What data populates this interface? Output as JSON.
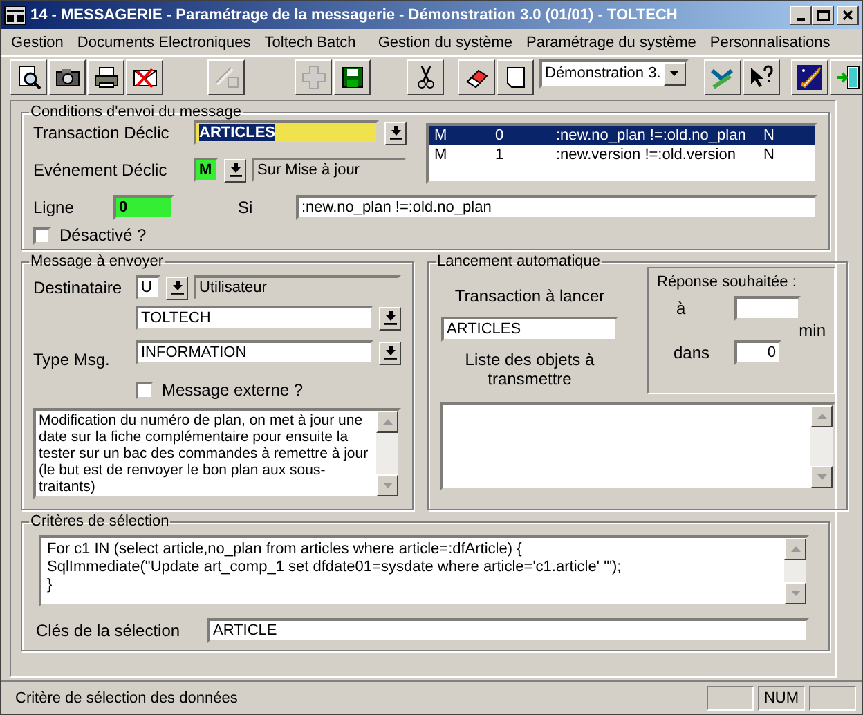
{
  "window": {
    "title": "14 - MESSAGERIE - Paramétrage de la messagerie - Démonstration 3.0 (01/01) - TOLTECH"
  },
  "menu": [
    "Gestion",
    "Documents Electroniques",
    "Toltech Batch",
    "Gestion du système",
    "Paramétrage du système",
    "Personnalisations"
  ],
  "toolbar": {
    "groups": [
      [
        {
          "kind": "search",
          "disabled": false
        },
        {
          "kind": "camera",
          "disabled": false
        },
        {
          "kind": "print",
          "disabled": false
        },
        {
          "kind": "mail-cross",
          "disabled": false
        }
      ],
      [
        {
          "kind": "validate",
          "disabled": true
        }
      ],
      [
        {
          "kind": "add",
          "disabled": true
        },
        {
          "kind": "save",
          "disabled": false
        }
      ],
      [
        {
          "kind": "cut",
          "disabled": false
        }
      ],
      [
        {
          "kind": "erase",
          "disabled": false
        },
        {
          "kind": "page",
          "disabled": false
        },
        {
          "kind": "combo",
          "value": "Démonstration 3."
        }
      ],
      [
        {
          "kind": "tools",
          "disabled": false
        },
        {
          "kind": "help",
          "disabled": false
        }
      ],
      [
        {
          "kind": "rocket",
          "disabled": false
        },
        {
          "kind": "exit",
          "disabled": false
        }
      ]
    ]
  },
  "conditions": {
    "title": "Conditions d'envoi du message",
    "transaction": {
      "label": "Transaction Déclic",
      "value": "ARTICLES",
      "text_selected": true
    },
    "event": {
      "label": "Evénement Déclic",
      "code": "M",
      "description": "Sur Mise à jour"
    },
    "line": {
      "label": "Ligne",
      "value": "0"
    },
    "condition": {
      "label": "Si",
      "value": ":new.no_plan !=:old.no_plan"
    },
    "disabled_checkbox": {
      "label": "Désactivé ?",
      "checked": false
    },
    "rules": [
      {
        "cells": [
          "M",
          "0",
          ":new.no_plan !=:old.no_plan",
          "N"
        ],
        "selected": true
      },
      {
        "cells": [
          "M",
          "1",
          ":new.version !=:old.version",
          "N"
        ],
        "selected": false
      }
    ]
  },
  "message": {
    "title": "Message à envoyer",
    "recipient": {
      "label": "Destinataire",
      "code": "U",
      "description": "Utilisateur",
      "value": "TOLTECH"
    },
    "type": {
      "label": "Type Msg.",
      "value": "INFORMATION"
    },
    "external": {
      "label": "Message externe ?",
      "checked": false
    },
    "body": "Modification du numéro de plan, on met à jour une date sur la fiche complémentaire pour ensuite la tester sur un bac des commandes à remettre à jour (le but est de renvoyer le bon plan aux sous-traitants)"
  },
  "launch": {
    "title": "Lancement automatique",
    "transaction": {
      "label": "Transaction à lancer",
      "value": "ARTICLES"
    },
    "objects_label": "Liste des objets à transmettre",
    "response": {
      "title": "Réponse souhaitée :",
      "at_label": "à",
      "unit": "min",
      "in_label": "dans",
      "in_value": "0"
    }
  },
  "criteria": {
    "title": "Critères de sélection",
    "code": "For c1 IN (select article,no_plan from articles where article=:dfArticle) {\nSqlImmediate(\"Update art_comp_1 set dfdate01=sysdate where article='c1.article' '\");\n}",
    "keys": {
      "label": "Clés de la sélection",
      "value": "ARTICLE"
    }
  },
  "status_bar": {
    "text": "Critère de sélection des données",
    "indicators": [
      "NUM"
    ]
  }
}
